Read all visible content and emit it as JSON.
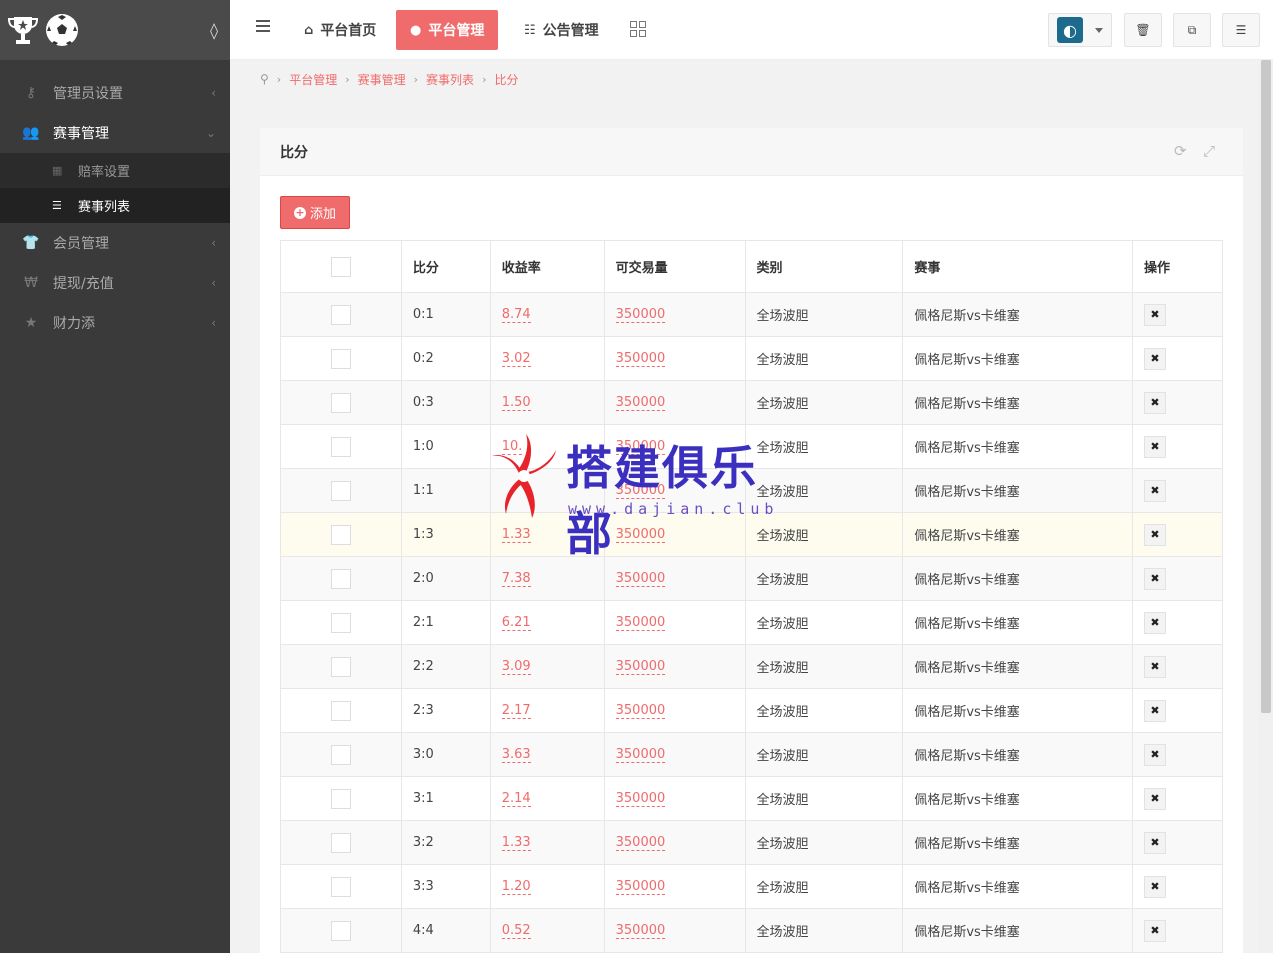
{
  "sidebar": {
    "items": [
      {
        "label": "管理员设置",
        "icon": "key-icon",
        "expanded": false
      },
      {
        "label": "赛事管理",
        "icon": "users-icon",
        "expanded": true
      },
      {
        "label": "会员管理",
        "icon": "shirt-icon",
        "expanded": false
      },
      {
        "label": "提现/充值",
        "icon": "won-icon",
        "expanded": false
      },
      {
        "label": "财力添",
        "icon": "star-icon",
        "expanded": false
      }
    ],
    "subitems": [
      {
        "label": "赔率设置",
        "icon": "grid-icon",
        "active": false
      },
      {
        "label": "赛事列表",
        "icon": "list-icon",
        "active": true
      }
    ]
  },
  "header": {
    "tabs": [
      {
        "label": "平台首页",
        "icon": "home-icon",
        "active": false
      },
      {
        "label": "平台管理",
        "icon": "user-icon",
        "active": true
      },
      {
        "label": "公告管理",
        "icon": "list-indent-icon",
        "active": false
      }
    ]
  },
  "breadcrumb": [
    "平台管理",
    "赛事管理",
    "赛事列表",
    "比分"
  ],
  "panel": {
    "title": "比分",
    "add_label": "添加"
  },
  "table": {
    "headers": [
      "比分",
      "收益率",
      "可交易量",
      "类别",
      "赛事",
      "操作"
    ],
    "rows": [
      {
        "score": "0:1",
        "rate": "8.74",
        "volume": "350000",
        "category": "全场波胆",
        "match": "佩格尼斯vs卡维塞"
      },
      {
        "score": "0:2",
        "rate": "3.02",
        "volume": "350000",
        "category": "全场波胆",
        "match": "佩格尼斯vs卡维塞"
      },
      {
        "score": "0:3",
        "rate": "1.50",
        "volume": "350000",
        "category": "全场波胆",
        "match": "佩格尼斯vs卡维塞"
      },
      {
        "score": "1:0",
        "rate": "10.",
        "volume": "350000",
        "category": "全场波胆",
        "match": "佩格尼斯vs卡维塞"
      },
      {
        "score": "1:1",
        "rate": "",
        "volume": "350000",
        "category": "全场波胆",
        "match": "佩格尼斯vs卡维塞"
      },
      {
        "score": "1:3",
        "rate": "1.33",
        "volume": "350000",
        "category": "全场波胆",
        "match": "佩格尼斯vs卡维塞"
      },
      {
        "score": "2:0",
        "rate": "7.38",
        "volume": "350000",
        "category": "全场波胆",
        "match": "佩格尼斯vs卡维塞"
      },
      {
        "score": "2:1",
        "rate": "6.21",
        "volume": "350000",
        "category": "全场波胆",
        "match": "佩格尼斯vs卡维塞"
      },
      {
        "score": "2:2",
        "rate": "3.09",
        "volume": "350000",
        "category": "全场波胆",
        "match": "佩格尼斯vs卡维塞"
      },
      {
        "score": "2:3",
        "rate": "2.17",
        "volume": "350000",
        "category": "全场波胆",
        "match": "佩格尼斯vs卡维塞"
      },
      {
        "score": "3:0",
        "rate": "3.63",
        "volume": "350000",
        "category": "全场波胆",
        "match": "佩格尼斯vs卡维塞"
      },
      {
        "score": "3:1",
        "rate": "2.14",
        "volume": "350000",
        "category": "全场波胆",
        "match": "佩格尼斯vs卡维塞"
      },
      {
        "score": "3:2",
        "rate": "1.33",
        "volume": "350000",
        "category": "全场波胆",
        "match": "佩格尼斯vs卡维塞"
      },
      {
        "score": "3:3",
        "rate": "1.20",
        "volume": "350000",
        "category": "全场波胆",
        "match": "佩格尼斯vs卡维塞"
      },
      {
        "score": "4:4",
        "rate": "0.52",
        "volume": "350000",
        "category": "全场波胆",
        "match": "佩格尼斯vs卡维塞"
      }
    ]
  },
  "watermark": {
    "text": "搭建俱乐部",
    "url": "www.dajian.club"
  },
  "colors": {
    "accent": "#f06b6b",
    "sidebar_bg": "#3a3a3a",
    "highlight_row": "#fdfcef"
  }
}
